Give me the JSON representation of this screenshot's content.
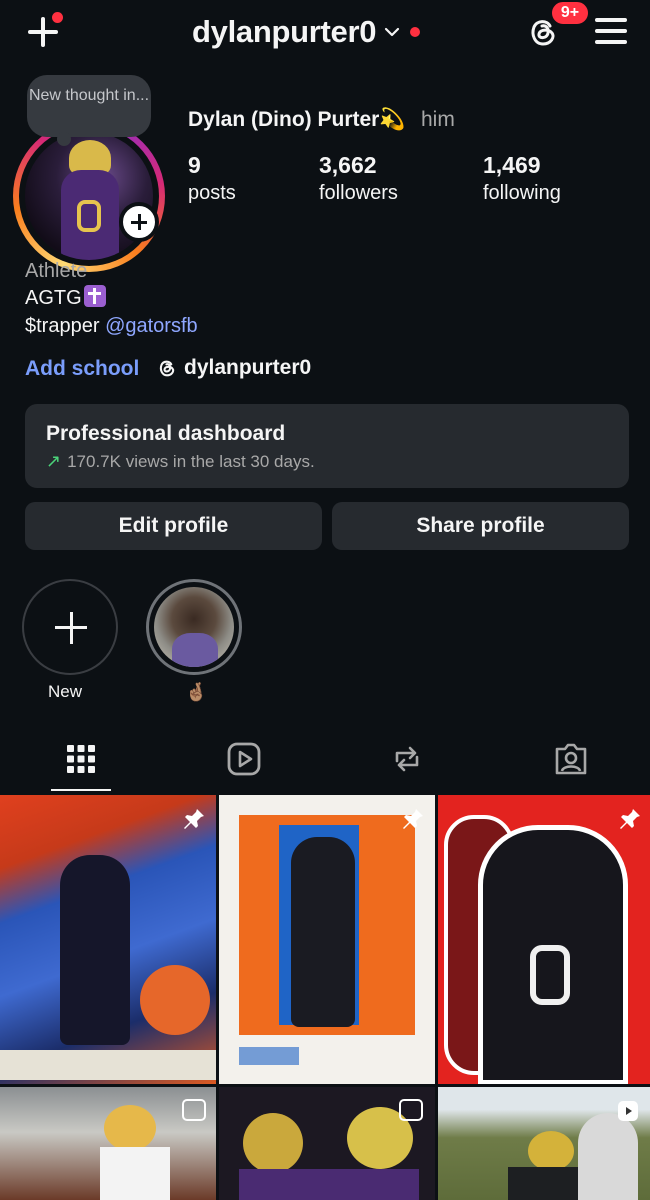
{
  "header": {
    "username": "dylanpurter0",
    "notification_badge": "9+"
  },
  "profile": {
    "note": "New thought in...",
    "full_name": "Dylan (Dino) Purter💫",
    "pronouns": "him",
    "stats": [
      {
        "value": "9",
        "label": "posts"
      },
      {
        "value": "3,662",
        "label": "followers"
      },
      {
        "value": "1,469",
        "label": "following"
      }
    ],
    "category": "Athlete",
    "bio_line1": "AGTG",
    "bio_line2_prefix": "$trapper ",
    "bio_mention": "@gatorsfb",
    "add_school": "Add school",
    "threads_handle": "dylanpurter0"
  },
  "dashboard": {
    "title": "Professional dashboard",
    "subtitle": "170.7K views in the last 30 days."
  },
  "buttons": {
    "edit": "Edit profile",
    "share": "Share profile"
  },
  "highlights": [
    {
      "label": "New"
    },
    {
      "label": "🤞🏽"
    }
  ],
  "tabs": [
    "grid-icon",
    "reels-icon",
    "reposts-icon",
    "tagged-icon"
  ],
  "accent": {
    "notification": "#ff3040",
    "link": "#7a9dfb",
    "trend": "#4bd37a"
  }
}
